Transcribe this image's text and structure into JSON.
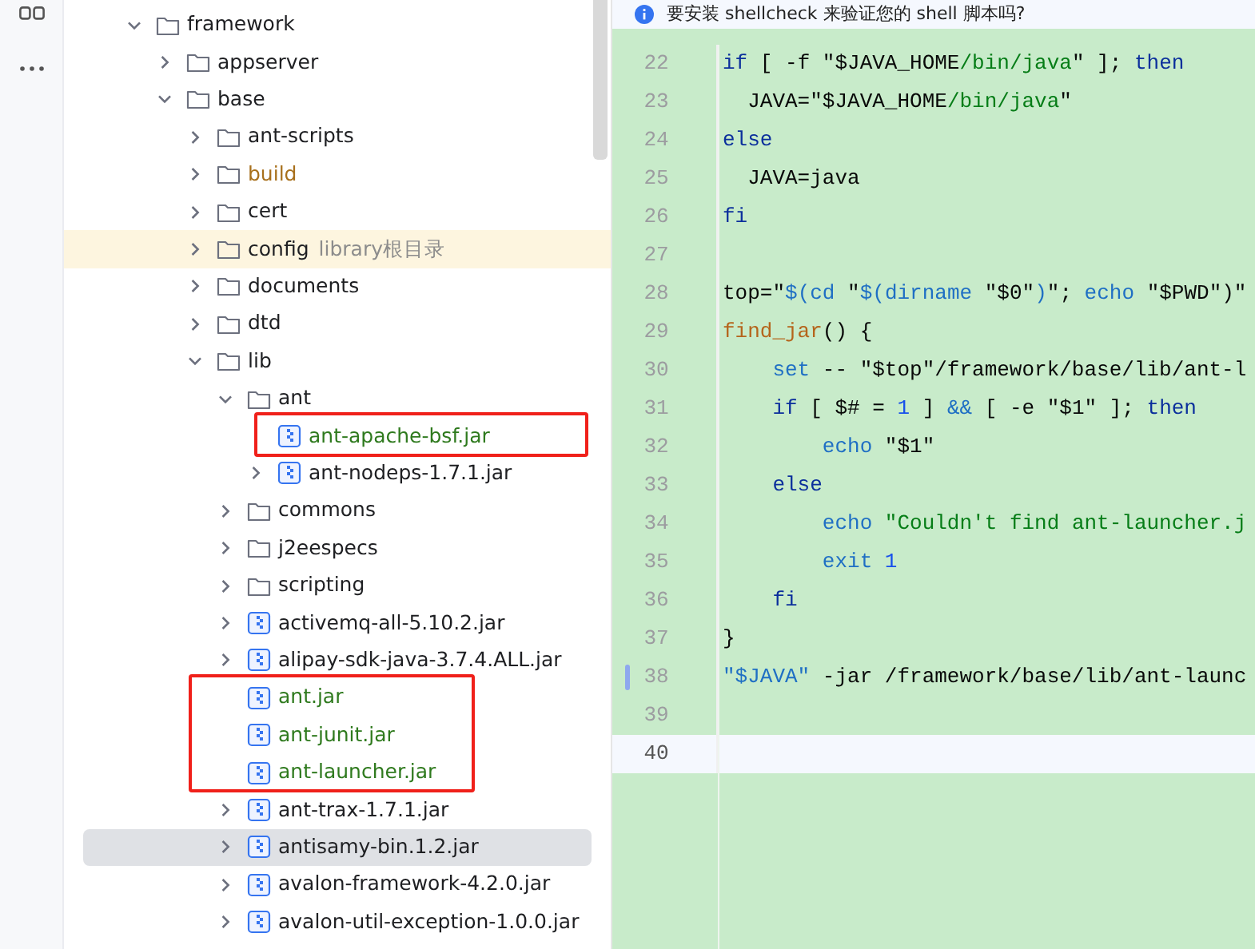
{
  "notification": {
    "text": "要安装 shellcheck 来验证您的 shell 脚本吗?"
  },
  "tree": [
    {
      "kind": "folder",
      "name": "framework",
      "expanded": true,
      "children": [
        {
          "kind": "folder",
          "name": "appserver",
          "expanded": false
        },
        {
          "kind": "folder",
          "name": "base",
          "expanded": true,
          "children": [
            {
              "kind": "folder",
              "name": "ant-scripts",
              "expanded": false
            },
            {
              "kind": "folder",
              "name": "build",
              "expanded": false,
              "color": "#a8701c"
            },
            {
              "kind": "folder",
              "name": "cert",
              "expanded": false
            },
            {
              "kind": "folder",
              "name": "config",
              "expanded": false,
              "hint": "library根目录",
              "highlighted": true
            },
            {
              "kind": "folder",
              "name": "documents",
              "expanded": false
            },
            {
              "kind": "folder",
              "name": "dtd",
              "expanded": false
            },
            {
              "kind": "folder",
              "name": "lib",
              "expanded": true,
              "children": [
                {
                  "kind": "folder",
                  "name": "ant",
                  "expanded": true,
                  "children": [
                    {
                      "kind": "jar",
                      "name": "ant-apache-bsf.jar",
                      "color": "#2f7a1e",
                      "boxed": true
                    },
                    {
                      "kind": "jar",
                      "name": "ant-nodeps-1.7.1.jar",
                      "expanded": false
                    }
                  ]
                },
                {
                  "kind": "folder",
                  "name": "commons",
                  "expanded": false
                },
                {
                  "kind": "folder",
                  "name": "j2eespecs",
                  "expanded": false
                },
                {
                  "kind": "folder",
                  "name": "scripting",
                  "expanded": false
                },
                {
                  "kind": "jar",
                  "name": "activemq-all-5.10.2.jar",
                  "expanded": false
                },
                {
                  "kind": "jar",
                  "name": "alipay-sdk-java-3.7.4.ALL.jar",
                  "expanded": false
                },
                {
                  "kind": "jar",
                  "name": "ant.jar",
                  "color": "#2f7a1e",
                  "boxed": true
                },
                {
                  "kind": "jar",
                  "name": "ant-junit.jar",
                  "color": "#2f7a1e",
                  "boxed": true
                },
                {
                  "kind": "jar",
                  "name": "ant-launcher.jar",
                  "color": "#2f7a1e",
                  "boxed": true
                },
                {
                  "kind": "jar",
                  "name": "ant-trax-1.7.1.jar",
                  "expanded": false
                },
                {
                  "kind": "jar",
                  "name": "antisamy-bin.1.2.jar",
                  "expanded": false,
                  "selected": true
                },
                {
                  "kind": "jar",
                  "name": "avalon-framework-4.2.0.jar",
                  "expanded": false
                },
                {
                  "kind": "jar",
                  "name": "avalon-util-exception-1.0.0.jar",
                  "expanded": false
                }
              ]
            }
          ]
        }
      ]
    }
  ],
  "editor": {
    "lines": [
      {
        "number": "22",
        "tokens": [
          {
            "kind": "keyword",
            "text": "if"
          },
          {
            "kind": "plain",
            "text": " [ -f \"$JAVA_HOME"
          },
          {
            "kind": "string",
            "text": "/bin/java"
          },
          {
            "kind": "plain",
            "text": "\" ]; "
          },
          {
            "kind": "keyword",
            "text": "then"
          }
        ]
      },
      {
        "number": "23",
        "tokens": [
          {
            "kind": "plain",
            "text": "  JAVA=\"$JAVA_HOME"
          },
          {
            "kind": "string",
            "text": "/bin/java"
          },
          {
            "kind": "plain",
            "text": "\""
          }
        ]
      },
      {
        "number": "24",
        "tokens": [
          {
            "kind": "keyword",
            "text": "else"
          }
        ]
      },
      {
        "number": "25",
        "tokens": [
          {
            "kind": "plain",
            "text": "  JAVA=java"
          }
        ]
      },
      {
        "number": "26",
        "tokens": [
          {
            "kind": "keyword",
            "text": "fi"
          }
        ]
      },
      {
        "number": "27"
      },
      {
        "number": "28",
        "tokens": [
          {
            "kind": "plain",
            "text": "top=\""
          },
          {
            "kind": "builtin",
            "text": "$(cd "
          },
          {
            "kind": "plain",
            "text": "\""
          },
          {
            "kind": "builtin",
            "text": "$(dirname "
          },
          {
            "kind": "plain",
            "text": "\"$0\""
          },
          {
            "kind": "builtin",
            "text": ")"
          },
          {
            "kind": "plain",
            "text": "\"; "
          },
          {
            "kind": "builtin",
            "text": "echo "
          },
          {
            "kind": "plain",
            "text": "\"$PWD\")\""
          }
        ]
      },
      {
        "number": "29",
        "tokens": [
          {
            "kind": "function",
            "text": "find_jar"
          },
          {
            "kind": "plain",
            "text": "() {"
          }
        ]
      },
      {
        "number": "30",
        "tokens": [
          {
            "kind": "builtin",
            "text": "    set"
          },
          {
            "kind": "plain",
            "text": " -- \"$top\"/framework/base/lib/ant-l"
          }
        ]
      },
      {
        "number": "31",
        "tokens": [
          {
            "kind": "keyword",
            "text": "    if"
          },
          {
            "kind": "plain",
            "text": " [ $# = "
          },
          {
            "kind": "number",
            "text": "1"
          },
          {
            "kind": "plain",
            "text": " ] "
          },
          {
            "kind": "builtin",
            "text": "&&"
          },
          {
            "kind": "plain",
            "text": " [ -e \"$1\" ]; "
          },
          {
            "kind": "keyword",
            "text": "then"
          }
        ]
      },
      {
        "number": "32",
        "tokens": [
          {
            "kind": "builtin",
            "text": "        echo"
          },
          {
            "kind": "plain",
            "text": " \"$1\""
          }
        ]
      },
      {
        "number": "33",
        "tokens": [
          {
            "kind": "keyword",
            "text": "    else"
          }
        ]
      },
      {
        "number": "34",
        "tokens": [
          {
            "kind": "builtin",
            "text": "        echo"
          },
          {
            "kind": "string",
            "text": " \"Couldn't find ant-launcher.j"
          }
        ]
      },
      {
        "number": "35",
        "tokens": [
          {
            "kind": "builtin",
            "text": "        exit"
          },
          {
            "kind": "number",
            "text": " 1"
          }
        ]
      },
      {
        "number": "36",
        "tokens": [
          {
            "kind": "keyword",
            "text": "    fi"
          }
        ]
      },
      {
        "number": "37",
        "tokens": [
          {
            "kind": "plain",
            "text": "}"
          }
        ]
      },
      {
        "number": "38",
        "tokens": [
          {
            "kind": "builtin",
            "text": "\"$JAVA\""
          },
          {
            "kind": "plain",
            "text": " -jar /framework/base/lib/ant-launc"
          }
        ],
        "changed": true
      },
      {
        "number": "39"
      },
      {
        "number": "40",
        "current": true
      }
    ]
  }
}
